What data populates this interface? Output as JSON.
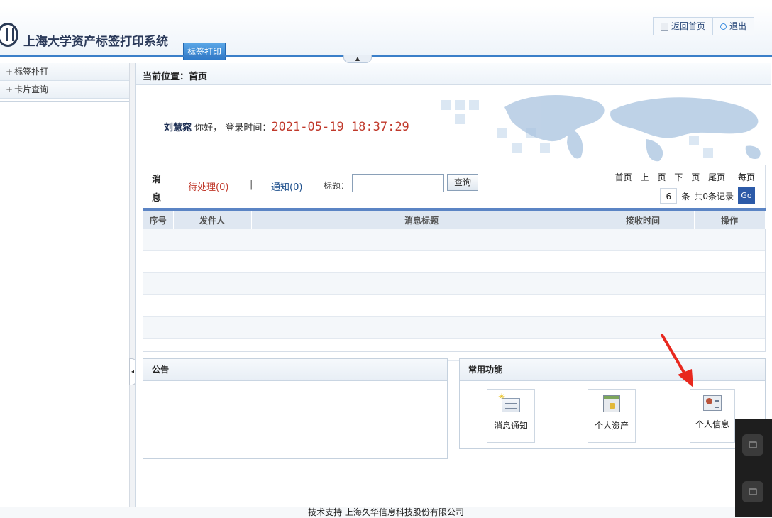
{
  "header": {
    "app_title": "上海大学资产标签打印系统",
    "active_tab": "标签打印",
    "links": [
      {
        "label": "返回首页",
        "icon": "home-icon"
      },
      {
        "label": "退出",
        "icon": "power-icon"
      }
    ]
  },
  "sidebar": {
    "items": [
      {
        "label": "标签补打"
      },
      {
        "label": "卡片查询"
      }
    ]
  },
  "main": {
    "breadcrumb": "当前位置：首页",
    "welcome": {
      "username": "刘慧窕",
      "greeting": "你好，",
      "login_label": "登录时间：",
      "login_time": "2021-05-19 18:37:29"
    },
    "messages": {
      "label": "消息",
      "pending": "待处理(0)",
      "separator": "|",
      "notice": "通知(0)",
      "title_label": "标题：",
      "title_value": "",
      "query_button": "查询",
      "pager": {
        "first": "首页",
        "prev": "上一页",
        "next": "下一页",
        "last": "尾页",
        "per_page_label": "每页",
        "page_size": "6",
        "unit": "条",
        "total": "共0条记录",
        "go": "Go"
      },
      "columns": [
        "序号",
        "发件人",
        "消息标题",
        "接收时间",
        "操作"
      ],
      "rows": []
    },
    "announcement_panel": {
      "title": "公告"
    },
    "functions_panel": {
      "title": "常用功能",
      "items": [
        {
          "label": "消息通知",
          "icon": "message-notice-icon"
        },
        {
          "label": "个人资产",
          "icon": "personal-asset-icon"
        },
        {
          "label": "个人信息",
          "icon": "personal-info-icon"
        }
      ]
    }
  },
  "footer": {
    "text": "技术支持 上海久华信息科技股份有限公司"
  },
  "colors": {
    "accent": "#3a7fc9",
    "header_title": "#2b3a5a",
    "pending_red": "#c0392b",
    "login_time_red": "#c0392b",
    "go_button": "#2c5aa8",
    "annotation_arrow": "#e8281e"
  }
}
